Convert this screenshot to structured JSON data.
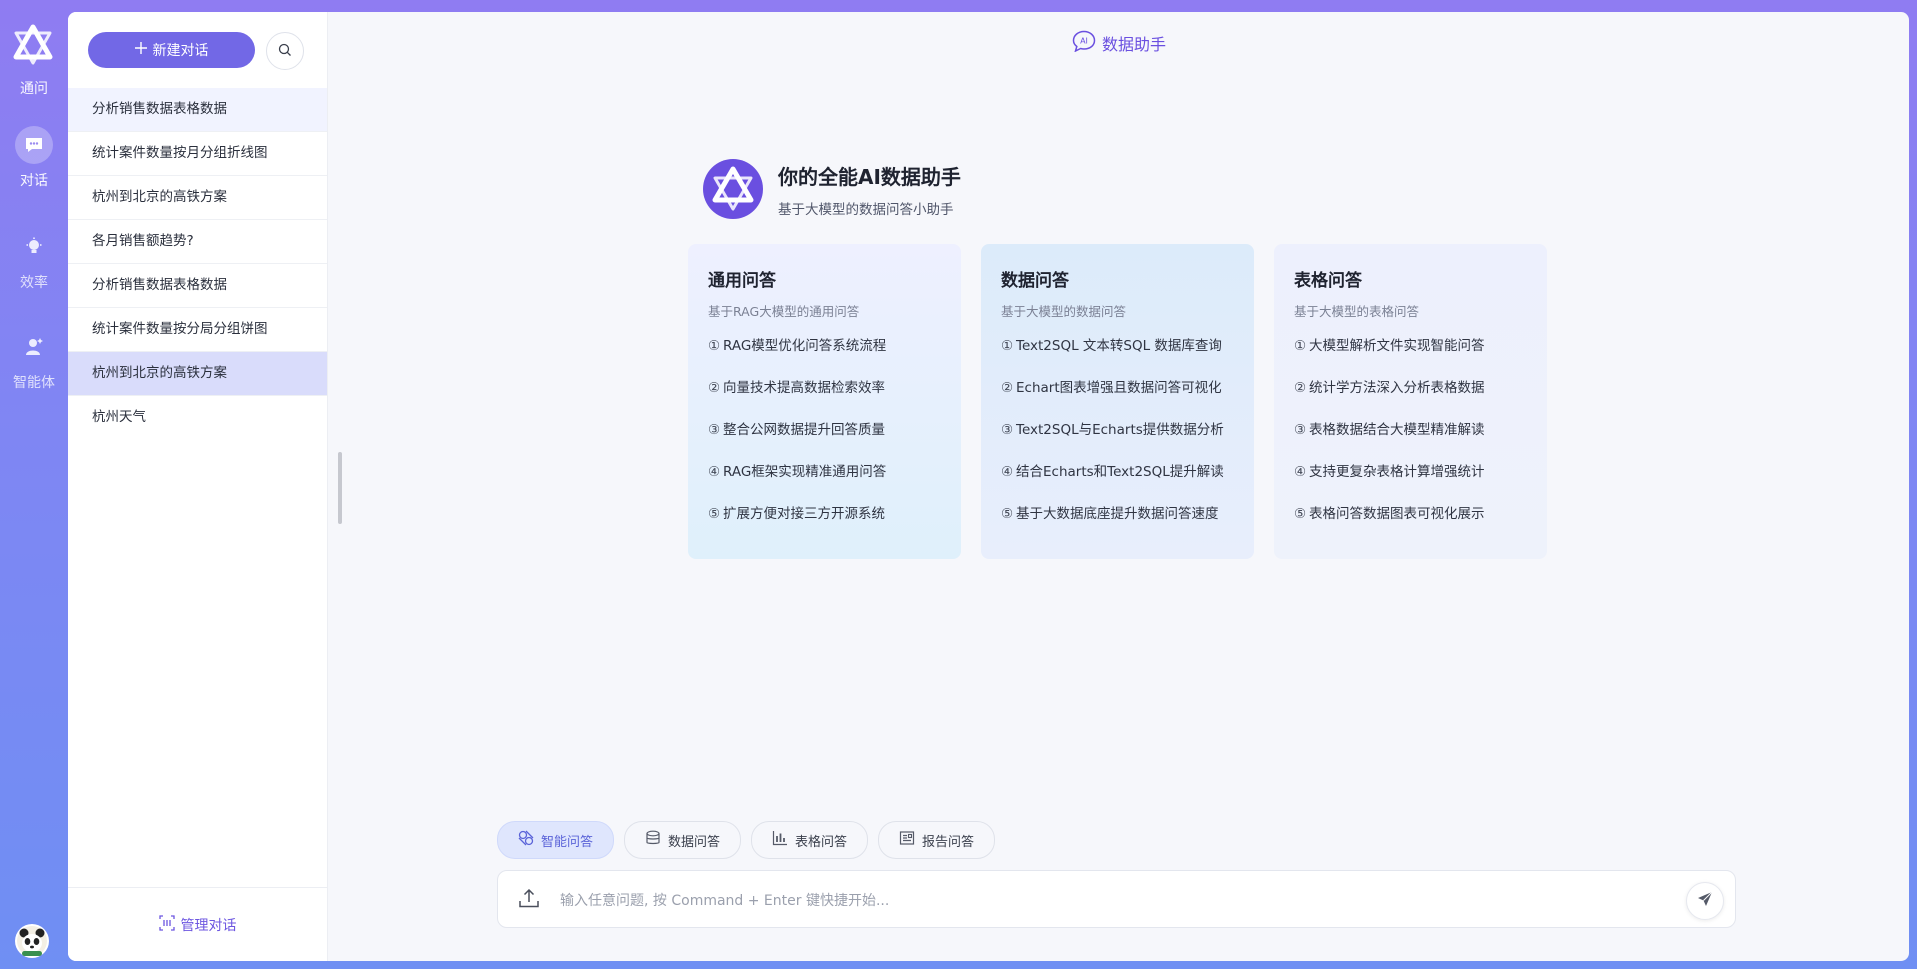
{
  "rail": {
    "items": [
      {
        "label": "通问",
        "icon": "app-logo-icon"
      },
      {
        "label": "对话",
        "icon": "chat-bubble-icon"
      },
      {
        "label": "效率",
        "icon": "lightbulb-icon"
      },
      {
        "label": "智能体",
        "icon": "agent-icon"
      }
    ]
  },
  "sidebar": {
    "new_chat_label": "新建对话",
    "conversations": [
      "分析销售数据表格数据",
      "统计案件数量按月分组折线图",
      "杭州到北京的高铁方案",
      "各月销售额趋势?",
      "分析销售数据表格数据",
      "统计案件数量按分局分组饼图",
      "杭州到北京的高铁方案",
      "杭州天气"
    ],
    "manage_label": "管理对话"
  },
  "header": {
    "title": "数据助手",
    "badge": "AI"
  },
  "hero": {
    "title": "你的全能AI数据助手",
    "subtitle": "基于大模型的数据问答小助手"
  },
  "cards": [
    {
      "title": "通用问答",
      "subtitle": "基于RAG大模型的通用问答",
      "items": [
        "RAG模型优化问答系统流程",
        "向量技术提高数据检索效率",
        "整合公网数据提升回答质量",
        "RAG框架实现精准通用问答",
        "扩展方便对接三方开源系统"
      ]
    },
    {
      "title": "数据问答",
      "subtitle": "基于大模型的数据问答",
      "items": [
        "Text2SQL 文本转SQL 数据库查询",
        "Echart图表增强且数据问答可视化",
        "Text2SQL与Echarts提供数据分析",
        "结合Echarts和Text2SQL提升解读",
        "基于大数据底座提升数据问答速度"
      ]
    },
    {
      "title": "表格问答",
      "subtitle": "基于大模型的表格问答",
      "items": [
        "大模型解析文件实现智能问答",
        "统计学方法深入分析表格数据",
        "表格数据结合大模型精准解读",
        "支持更复杂表格计算增强统计",
        "表格问答数据图表可视化展示"
      ]
    }
  ],
  "numbers": [
    "①",
    "②",
    "③",
    "④",
    "⑤"
  ],
  "modes": [
    {
      "label": "智能问答",
      "icon": "smart-qa-icon"
    },
    {
      "label": "数据问答",
      "icon": "database-icon"
    },
    {
      "label": "表格问答",
      "icon": "bar-chart-icon"
    },
    {
      "label": "报告问答",
      "icon": "report-icon"
    }
  ],
  "input": {
    "placeholder": "输入任意问题, 按 Command + Enter 键快捷开始..."
  },
  "colors": {
    "accent": "#7268e6",
    "brand_text": "#6a4fe0",
    "selected_row": "#d9dcfb"
  }
}
